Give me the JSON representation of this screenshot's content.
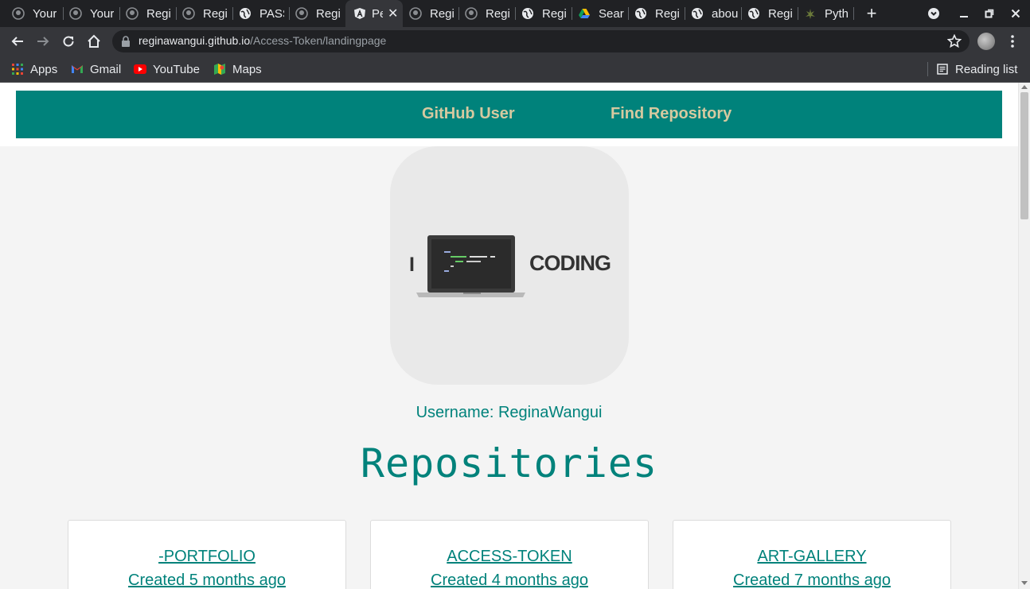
{
  "browser": {
    "tabs": [
      {
        "title": "Your",
        "icon": "github-icon"
      },
      {
        "title": "Your",
        "icon": "github-icon"
      },
      {
        "title": "Regi",
        "icon": "github-icon"
      },
      {
        "title": "Regi",
        "icon": "github-icon"
      },
      {
        "title": "PASS",
        "icon": "globe-icon"
      },
      {
        "title": "Regi",
        "icon": "github-icon"
      },
      {
        "title": "Pe",
        "icon": "angular-icon",
        "active": true
      },
      {
        "title": "Regi",
        "icon": "github-icon"
      },
      {
        "title": "Regi",
        "icon": "github-icon"
      },
      {
        "title": "Regi",
        "icon": "globe-icon"
      },
      {
        "title": "Sear",
        "icon": "google-drive-icon"
      },
      {
        "title": "Regi",
        "icon": "globe-icon"
      },
      {
        "title": "abou",
        "icon": "globe-icon"
      },
      {
        "title": "Regi",
        "icon": "globe-icon"
      },
      {
        "title": "Pyth",
        "icon": "python-icon"
      }
    ],
    "url_host": "reginawangui.github.io",
    "url_path": "/Access-Token/landingpage",
    "bookmarks": [
      {
        "label": "Apps",
        "icon": "apps-grid-icon"
      },
      {
        "label": "Gmail",
        "icon": "gmail-icon"
      },
      {
        "label": "YouTube",
        "icon": "youtube-icon"
      },
      {
        "label": "Maps",
        "icon": "maps-icon"
      }
    ],
    "reading_list": "Reading list"
  },
  "nav": {
    "github_user": "GitHub User",
    "find_repository": "Find Repository"
  },
  "profile": {
    "avatar_text_left": "I",
    "avatar_text_right": "CODING",
    "username": "Username: ReginaWangui"
  },
  "repos_heading": "Repositories",
  "repos": [
    {
      "name": "-PORTFOLIO",
      "created": "Created 5 months ago"
    },
    {
      "name": "ACCESS-TOKEN",
      "created": "Created 4 months ago"
    },
    {
      "name": "ART-GALLERY",
      "created": "Created 7 months ago"
    }
  ],
  "colors": {
    "teal": "#00827b",
    "nav_link": "#d6c9a0",
    "chrome_dark": "#202124",
    "chrome_toolbar": "#35363a"
  }
}
